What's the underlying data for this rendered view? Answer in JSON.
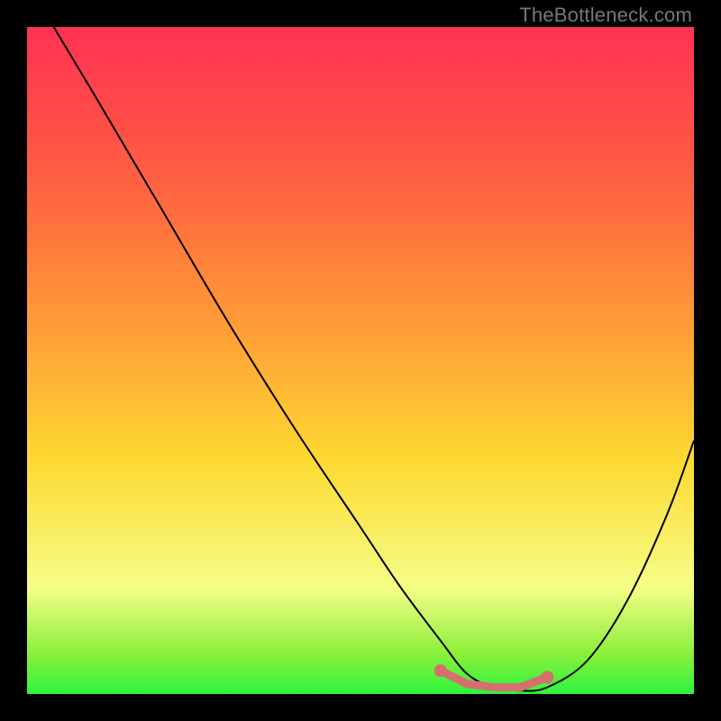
{
  "watermark": "TheBottleneck.com",
  "chart_data": {
    "type": "line",
    "title": "",
    "xlabel": "",
    "ylabel": "",
    "xlim": [
      0,
      100
    ],
    "ylim": [
      0,
      100
    ],
    "grid": false,
    "note": "Axes carry no numeric tick labels in the source image; values below are estimated relative coordinates (0–100) read from geometry.",
    "series": [
      {
        "name": "bottleneck-curve",
        "x": [
          4,
          10,
          20,
          30,
          40,
          50,
          56,
          62,
          66,
          70,
          74,
          78,
          84,
          90,
          96,
          100
        ],
        "y": [
          100,
          90,
          73,
          56,
          40,
          25,
          16,
          8,
          3,
          1,
          0.5,
          1,
          5,
          14,
          27,
          38
        ]
      }
    ],
    "highlight": {
      "name": "optimal-range",
      "x": [
        62,
        66,
        70,
        74,
        78
      ],
      "y": [
        3.5,
        1.5,
        1,
        1,
        2.5
      ],
      "endpoints": [
        {
          "x": 62,
          "y": 3.5
        },
        {
          "x": 78,
          "y": 2.5
        }
      ]
    },
    "gradient_stops": [
      {
        "pos": 0,
        "color": "#2cf53e"
      },
      {
        "pos": 6,
        "color": "#8aef3a"
      },
      {
        "pos": 16,
        "color": "#f6fe87"
      },
      {
        "pos": 35,
        "color": "#fdd931"
      },
      {
        "pos": 55,
        "color": "#ff9d37"
      },
      {
        "pos": 72,
        "color": "#ff6d3e"
      },
      {
        "pos": 86,
        "color": "#ff4c48"
      },
      {
        "pos": 100,
        "color": "#ff3253"
      }
    ]
  }
}
